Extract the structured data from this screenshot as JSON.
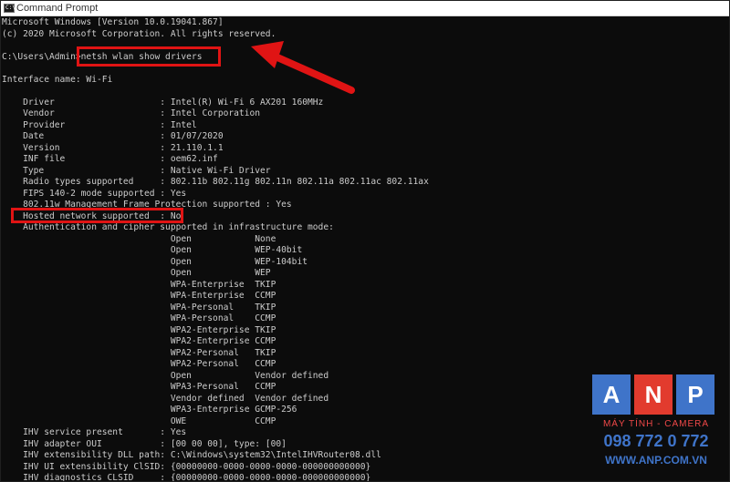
{
  "window": {
    "title": "Command Prompt",
    "icon": "cmd-icon"
  },
  "console_lines": [
    "Microsoft Windows [Version 10.0.19041.867]",
    "(c) 2020 Microsoft Corporation. All rights reserved.",
    "",
    "C:\\Users\\Admin>netsh wlan show drivers",
    "",
    "Interface name: Wi-Fi",
    "",
    "    Driver                    : Intel(R) Wi-Fi 6 AX201 160MHz",
    "    Vendor                    : Intel Corporation",
    "    Provider                  : Intel",
    "    Date                      : 01/07/2020",
    "    Version                   : 21.110.1.1",
    "    INF file                  : oem62.inf",
    "    Type                      : Native Wi-Fi Driver",
    "    Radio types supported     : 802.11b 802.11g 802.11n 802.11a 802.11ac 802.11ax",
    "    FIPS 140-2 mode supported : Yes",
    "    802.11w Management Frame Protection supported : Yes",
    "    Hosted network supported  : No",
    "    Authentication and cipher supported in infrastructure mode:",
    "                                Open            None",
    "                                Open            WEP-40bit",
    "                                Open            WEP-104bit",
    "                                Open            WEP",
    "                                WPA-Enterprise  TKIP",
    "                                WPA-Enterprise  CCMP",
    "                                WPA-Personal    TKIP",
    "                                WPA-Personal    CCMP",
    "                                WPA2-Enterprise TKIP",
    "                                WPA2-Enterprise CCMP",
    "                                WPA2-Personal   TKIP",
    "                                WPA2-Personal   CCMP",
    "                                Open            Vendor defined",
    "                                WPA3-Personal   CCMP",
    "                                Vendor defined  Vendor defined",
    "                                WPA3-Enterprise GCMP-256",
    "                                OWE             CCMP",
    "    IHV service present       : Yes",
    "    IHV adapter OUI           : [00 00 00], type: [00]",
    "    IHV extensibility DLL path: C:\\Windows\\system32\\IntelIHVRouter08.dll",
    "    IHV UI extensibility ClSID: {00000000-0000-0000-0000-000000000000}",
    "    IHV diagnostics CLSID     : {00000000-0000-0000-0000-000000000000}"
  ],
  "annotations": {
    "highlight_color": "#e01414",
    "highlighted": [
      "netsh wlan show drivers",
      "Hosted network supported  : No"
    ]
  },
  "watermark": {
    "letters": [
      "A",
      "N",
      "P"
    ],
    "tagline": "MÁY TÍNH - CAMERA",
    "phone": "098 772 0 772",
    "website": "WWW.ANP.COM.VN",
    "colors": {
      "blue": "#3f74c9",
      "red": "#e23b2e"
    }
  }
}
